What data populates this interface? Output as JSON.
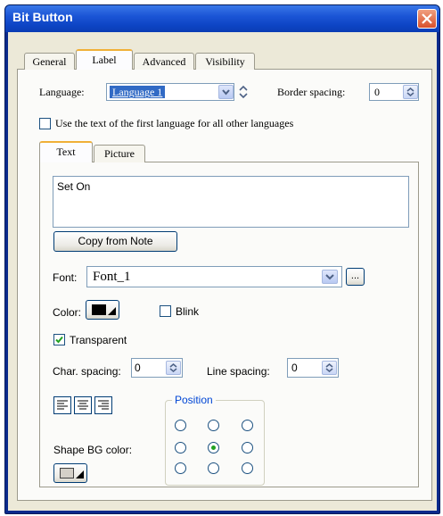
{
  "window": {
    "title": "Bit Button"
  },
  "tabs": [
    {
      "label": "General"
    },
    {
      "label": "Label"
    },
    {
      "label": "Advanced"
    },
    {
      "label": "Visibility"
    }
  ],
  "language": {
    "label": "Language:",
    "value": "Language 1"
  },
  "border_spacing": {
    "label": "Border spacing:",
    "value": "0"
  },
  "use_first_language": {
    "label": "Use the text of the first language for all other languages",
    "checked": false
  },
  "subtabs": [
    {
      "label": "Text"
    },
    {
      "label": "Picture"
    }
  ],
  "text_value": "Set On",
  "copy_from_note": "Copy from Note",
  "font": {
    "label": "Font:",
    "value": "Font_1",
    "browse_label": "..."
  },
  "color": {
    "label": "Color:",
    "swatch": "#000000"
  },
  "blink": {
    "label": "Blink",
    "checked": false
  },
  "transparent": {
    "label": "Transparent",
    "checked": true
  },
  "char_spacing": {
    "label": "Char. spacing:",
    "value": "0"
  },
  "line_spacing": {
    "label": "Line spacing:",
    "value": "0"
  },
  "position": {
    "label": "Position",
    "selected": "center"
  },
  "shape_bg_color": {
    "label": "Shape BG color:"
  },
  "colors": {
    "title_bar": "#0d44c4",
    "dialog_bg": "#ece9d8",
    "tab_highlight": "#f0b038",
    "check_mark": "#21a121"
  }
}
